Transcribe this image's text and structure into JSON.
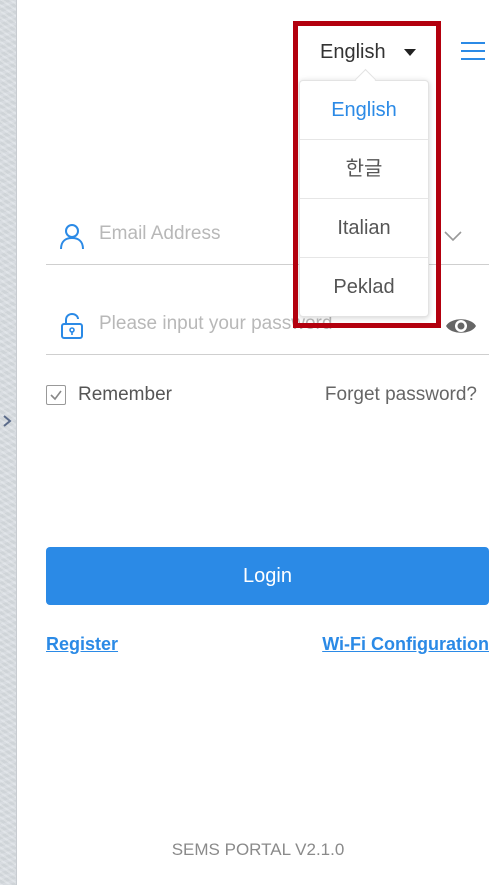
{
  "header": {
    "language_selected": "English"
  },
  "language_dropdown": {
    "items": [
      "English",
      "한글",
      "Italian",
      "Peklad"
    ],
    "active_index": 0
  },
  "form": {
    "email_placeholder": "Email Address",
    "password_placeholder": "Please input your password",
    "remember_label": "Remember",
    "remember_checked": true,
    "forget_label": "Forget password?",
    "login_label": "Login"
  },
  "links": {
    "register": "Register",
    "wifi": "Wi-Fi Configuration"
  },
  "footer": {
    "version": "SEMS PORTAL V2.1.0"
  },
  "colors": {
    "accent": "#2b8ae6",
    "highlight_box": "#b3000e"
  }
}
